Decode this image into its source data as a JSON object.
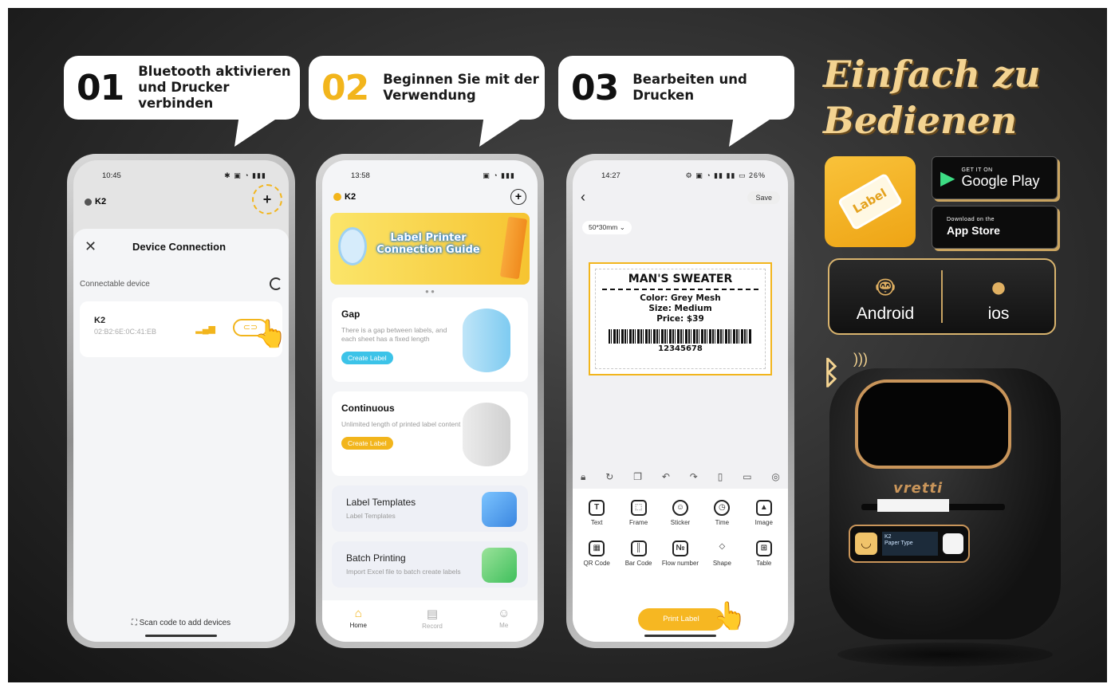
{
  "steps": [
    {
      "num": "01",
      "text_line1": "Bluetooth aktivieren",
      "text_line2": "und Drucker verbinden"
    },
    {
      "num": "02",
      "text_line1": "Beginnen Sie mit der",
      "text_line2": "Verwendung"
    },
    {
      "num": "03",
      "text_line1": "Bearbeiten und",
      "text_line2": "Drucken"
    }
  ],
  "headline": {
    "line1": "Einfach zu",
    "line2": "Bedienen"
  },
  "phone1": {
    "time": "10:45",
    "device_title": "K2",
    "sheet_title": "Device Connection",
    "section_label": "Connectable device",
    "device": {
      "name": "K2",
      "mac": "02:B2:6E:0C:41:EB"
    },
    "scan_label": "Scan code to add devices"
  },
  "phone2": {
    "time": "13:58",
    "device_title": "K2",
    "banner_text": "Label Printer Connection Guide",
    "cards": [
      {
        "title": "Gap",
        "desc": "There is a gap between labels, and each sheet has a fixed length",
        "button": "Create Label"
      },
      {
        "title": "Continuous",
        "desc": "Unlimited length of printed label content",
        "button": "Create Label"
      }
    ],
    "list": [
      {
        "title": "Label Templates",
        "desc": "Label Templates"
      },
      {
        "title": "Batch Printing",
        "desc": "Import Excel file to batch create labels"
      }
    ],
    "tabs": [
      "Home",
      "Record",
      "Me"
    ]
  },
  "phone3": {
    "time": "14:27",
    "battery": "26%",
    "save_label": "Save",
    "size_label": "50*30mm",
    "label": {
      "title": "MAN'S SWEATER",
      "line1": "Color: Grey Mesh",
      "line2": "Size: Medium",
      "line3": "Price: $39",
      "barcode_number": "12345678"
    },
    "tools": [
      "Text",
      "Frame",
      "Sticker",
      "Time",
      "Image",
      "QR Code",
      "Bar Code",
      "Flow number",
      "Shape",
      "Table"
    ],
    "print_label": "Print Label"
  },
  "stores": {
    "google_small": "GET IT ON",
    "google_big": "Google Play",
    "apple_small": "Download on the",
    "apple_big": "App Store"
  },
  "app_icon_text": "Label",
  "platforms": {
    "android": "Android",
    "ios": "ios"
  },
  "printer": {
    "brand": "vretti",
    "lcd_line1": "K2",
    "lcd_line2": "Paper Type"
  },
  "colors": {
    "accent_gold": "#f2b51c",
    "headline_gold": "#f3d391",
    "background_dark": "#2b2b2b"
  }
}
